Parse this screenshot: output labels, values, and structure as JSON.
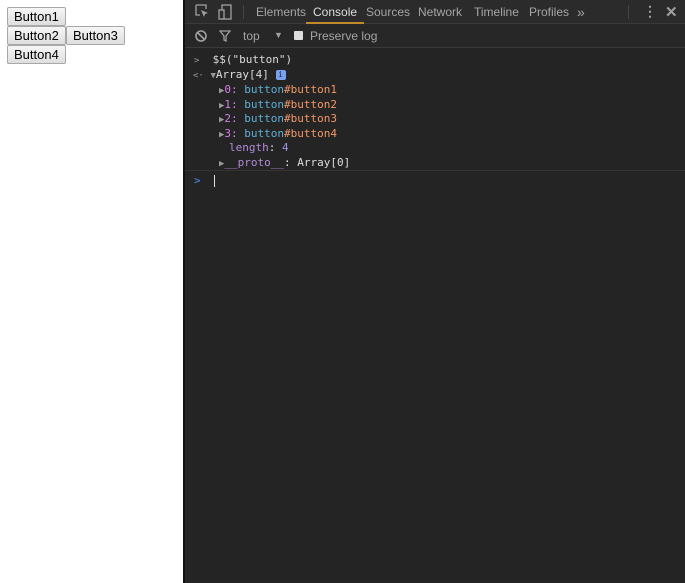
{
  "page": {
    "buttons": [
      "Button1",
      "Button2",
      "Button3",
      "Button4"
    ]
  },
  "devtools": {
    "tabs": [
      "Elements",
      "Console",
      "Sources",
      "Network",
      "Timeline",
      "Profiles"
    ],
    "active_tab": "Console",
    "more_tabs": "»",
    "context": "top",
    "preserve_log": "Preserve log",
    "preserve_log_checked": false
  },
  "console": {
    "input": "$$(\"button\")",
    "result_label": "Array[4]",
    "info_badge": "i",
    "items": [
      {
        "index": "0",
        "tag": "button",
        "id": "#button1"
      },
      {
        "index": "1",
        "tag": "button",
        "id": "#button2"
      },
      {
        "index": "2",
        "tag": "button",
        "id": "#button3"
      },
      {
        "index": "3",
        "tag": "button",
        "id": "#button4"
      }
    ],
    "length_key": "length",
    "length_value": "4",
    "proto_key": "__proto__",
    "proto_value": "Array[0]"
  }
}
